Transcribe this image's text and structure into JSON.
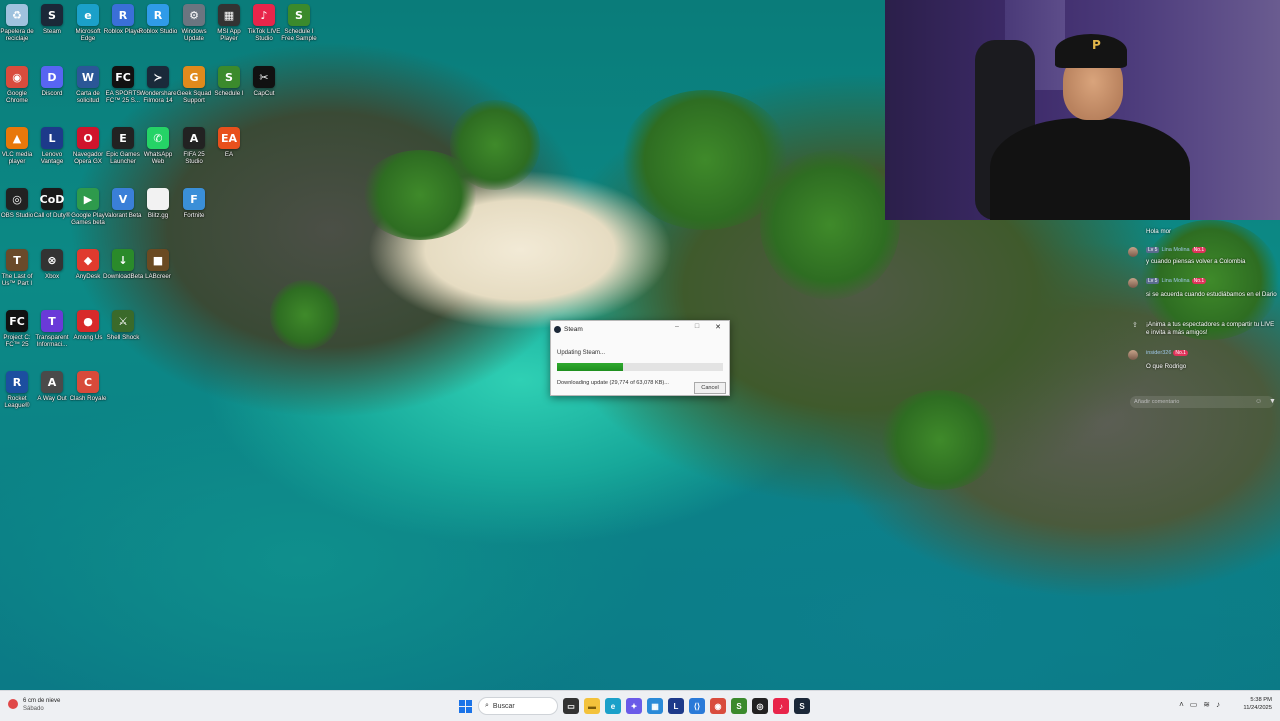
{
  "desktop_icons": [
    {
      "label": "Papelera de reciclaje",
      "icon": "recycle-bin-icon",
      "color": "#9fc2de",
      "glyph": "♻"
    },
    {
      "label": "Steam",
      "icon": "steam-icon",
      "color": "#1b2838",
      "glyph": "S"
    },
    {
      "label": "Microsoft Edge",
      "icon": "edge-icon",
      "color": "#1ba0c9",
      "glyph": "e"
    },
    {
      "label": "Roblox Player",
      "icon": "roblox-icon",
      "color": "#3a6fd8",
      "glyph": "R"
    },
    {
      "label": "Roblox Studio",
      "icon": "roblox-studio-icon",
      "color": "#2f9be8",
      "glyph": "R"
    },
    {
      "label": "Windows Update",
      "icon": "windows-update-icon",
      "color": "#6b7580",
      "glyph": "⚙"
    },
    {
      "label": "MSI App Player",
      "icon": "msi-app-player-icon",
      "color": "#333",
      "glyph": "▦"
    },
    {
      "label": "TikTok LIVE Studio",
      "icon": "tiktok-live-icon",
      "color": "#e8254a",
      "glyph": "♪"
    },
    {
      "label": "Schedule I Free Sample",
      "icon": "schedule-i-icon",
      "color": "#3b8a2c",
      "glyph": "S"
    },
    {
      "label": "Google Chrome",
      "icon": "chrome-icon",
      "color": "#d94c3d",
      "glyph": "◉"
    },
    {
      "label": "Discord",
      "icon": "discord-icon",
      "color": "#5865f2",
      "glyph": "D"
    },
    {
      "label": "Carta de solicitud",
      "icon": "word-doc-icon",
      "color": "#2b5797",
      "glyph": "W"
    },
    {
      "label": "EA SPORTS FC™ 25 S...",
      "icon": "ea-fc-icon",
      "color": "#111",
      "glyph": "FC"
    },
    {
      "label": "Wondershare Filmora 14",
      "icon": "filmora-icon",
      "color": "#1a2a3a",
      "glyph": "≻"
    },
    {
      "label": "Geek Squad Support",
      "icon": "geek-squad-icon",
      "color": "#e08a1c",
      "glyph": "G"
    },
    {
      "label": "Schedule I",
      "icon": "schedule-i-icon-2",
      "color": "#3b8a2c",
      "glyph": "S"
    },
    {
      "label": "CapCut",
      "icon": "capcut-icon",
      "color": "#111",
      "glyph": "✂"
    },
    {
      "label": "VLC media player",
      "icon": "vlc-icon",
      "color": "#e8780a",
      "glyph": "▲"
    },
    {
      "label": "Lenovo Vantage",
      "icon": "lenovo-vantage-icon",
      "color": "#1d3a8a",
      "glyph": "L"
    },
    {
      "label": "Navegador Opera GX",
      "icon": "opera-gx-icon",
      "color": "#d0142c",
      "glyph": "O"
    },
    {
      "label": "Epic Games Launcher",
      "icon": "epic-games-icon",
      "color": "#222",
      "glyph": "E"
    },
    {
      "label": "WhatsApp Web",
      "icon": "whatsapp-icon",
      "color": "#25d366",
      "glyph": "✆"
    },
    {
      "label": "FIFA 25 Studio",
      "icon": "fifa-icon",
      "color": "#222",
      "glyph": "A"
    },
    {
      "label": "EA",
      "icon": "ea-icon",
      "color": "#e8501c",
      "glyph": "EA"
    },
    {
      "label": "OBS Studio",
      "icon": "obs-icon",
      "color": "#222",
      "glyph": "◎"
    },
    {
      "label": "Call of Duty®",
      "icon": "call-of-duty-icon",
      "color": "#1a1a1a",
      "glyph": "CoD"
    },
    {
      "label": "Google Play Games beta",
      "icon": "google-play-games-icon",
      "color": "#2e9a4c",
      "glyph": "▶"
    },
    {
      "label": "Valorant Beta",
      "icon": "valorant-icon",
      "color": "#3a7fd8",
      "glyph": "V"
    },
    {
      "label": "Blitz.gg",
      "icon": "file-icon",
      "color": "#f2f2f2",
      "glyph": ""
    },
    {
      "label": "Fortnite",
      "icon": "fortnite-icon",
      "color": "#3a8fd8",
      "glyph": "F"
    },
    {
      "label": "The Last of Us™ Part I",
      "icon": "last-of-us-icon",
      "color": "#6a4a2a",
      "glyph": "T"
    },
    {
      "label": "Xbox",
      "icon": "xbox-icon",
      "color": "#333",
      "glyph": "⊗"
    },
    {
      "label": "AnyDesk",
      "icon": "anydesk-icon",
      "color": "#e03a2e",
      "glyph": "◆"
    },
    {
      "label": "DownloadBeta",
      "icon": "download-icon",
      "color": "#2a8a2a",
      "glyph": "↓"
    },
    {
      "label": "LABcreer",
      "icon": "minecraft-icon",
      "color": "#6a4a22",
      "glyph": "■"
    },
    {
      "label": "Project C: FC™ 25",
      "icon": "project-fc-icon",
      "color": "#111",
      "glyph": "FC"
    },
    {
      "label": "Transparent Informaci...",
      "icon": "transparent-icon",
      "color": "#6a3ad8",
      "glyph": "T"
    },
    {
      "label": "Among Us",
      "icon": "among-us-icon",
      "color": "#d82a2a",
      "glyph": "●"
    },
    {
      "label": "Shell Shock",
      "icon": "shell-icon",
      "color": "#3a6a2a",
      "glyph": "⚔"
    },
    {
      "label": "Rocket League®",
      "icon": "rocket-league-icon",
      "color": "#1c4fa0",
      "glyph": "R"
    },
    {
      "label": "A Way Out",
      "icon": "a-way-out-icon",
      "color": "#4a4a4a",
      "glyph": "A"
    },
    {
      "label": "Clash Royale",
      "icon": "clash-royale-icon",
      "color": "#d84a3a",
      "glyph": "C"
    }
  ],
  "dialog": {
    "title": "Steam",
    "status": "Updating Steam...",
    "progress": 0.4,
    "detail": "Downloading update (29,774 of 63,078 KB)...",
    "cancel_label": "Cancel",
    "accent": "#2faa2f"
  },
  "chat": {
    "messages": [
      {
        "text": "Hola mor"
      },
      {
        "user": "Lina Molina",
        "level": "Lv 5",
        "fan": "No.1",
        "text": "y cuando piensas volver a Colombia"
      },
      {
        "user": "Lina Molina",
        "level": "Lv 5",
        "fan": "No.1",
        "text": "si se acuerda cuando estudiábamos en el Dario"
      },
      {
        "text": "¡Anima a tus espectadores a compartir tu LIVE e invita a más amigos!"
      },
      {
        "user": "insider326",
        "fan": "No.1",
        "text": "O que Rodrigo"
      }
    ],
    "input_placeholder": "Añadir comentario"
  },
  "taskbar": {
    "weather_temp": "6 cm de nieve",
    "weather_desc": "Sábado",
    "search_label": "Buscar",
    "time": "5:38 PM",
    "date": "11/24/2025"
  }
}
